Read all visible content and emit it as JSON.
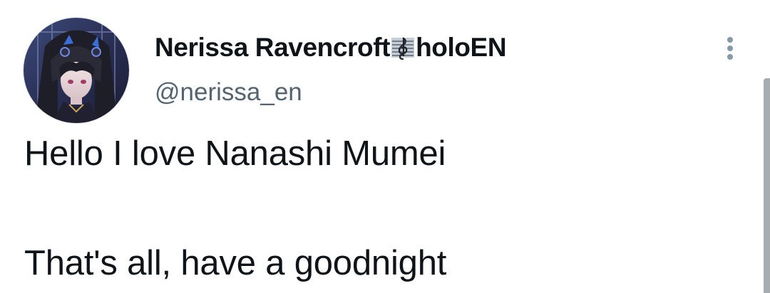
{
  "author": {
    "display_name": "Nerissa Ravencroft",
    "display_name_suffix": "holoEN",
    "name_badge_icon": "music-staff-treble-clef-icon",
    "handle": "@nerissa_en",
    "avatar_icon": "profile-avatar-anime-character"
  },
  "tweet": {
    "lines": [
      "Hello I love Nanashi Mumei",
      "That's all, have a goodnight"
    ]
  },
  "controls": {
    "more_icon": "more-options-vertical-dots-icon"
  },
  "colors": {
    "text_primary": "#0f1419",
    "text_secondary": "#536471",
    "icon_gray": "#8899a6",
    "background": "#ffffff"
  }
}
